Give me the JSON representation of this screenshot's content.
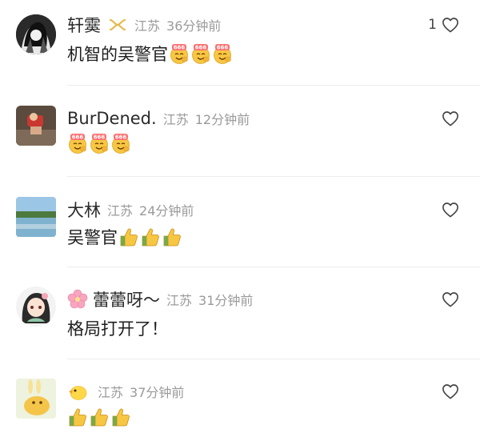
{
  "comments": [
    {
      "name": "轩霙",
      "location": "江苏",
      "time": "36分钟前",
      "text": "机智的吴警官",
      "likes": "1",
      "emojis": [
        "666-emoji",
        "666-emoji",
        "666-emoji"
      ]
    },
    {
      "name": "BurDened.",
      "location": "江苏",
      "time": "12分钟前",
      "text": "",
      "likes": "",
      "emojis": [
        "666-emoji",
        "666-emoji",
        "666-emoji"
      ]
    },
    {
      "name": "大林",
      "location": "江苏",
      "time": "24分钟前",
      "text": "吴警官",
      "likes": "",
      "emojis": [
        "thumbs-up-emoji",
        "thumbs-up-emoji",
        "thumbs-up-emoji"
      ]
    },
    {
      "name": "蕾蕾呀～",
      "location": "江苏",
      "time": "31分钟前",
      "text": "格局打开了！",
      "likes": "",
      "name_emoji": "cherry-blossom-emoji"
    },
    {
      "name": "",
      "location": "江苏",
      "time": "37分钟前",
      "text": "",
      "likes": "",
      "name_emoji": "chick-emoji",
      "emojis": [
        "thumbs-up-emoji",
        "thumbs-up-emoji",
        "thumbs-up-emoji"
      ]
    }
  ],
  "colors": {
    "meta_gray": "#9a9a9a",
    "badge_gold": "#e6b94a",
    "divider": "#ececec"
  }
}
